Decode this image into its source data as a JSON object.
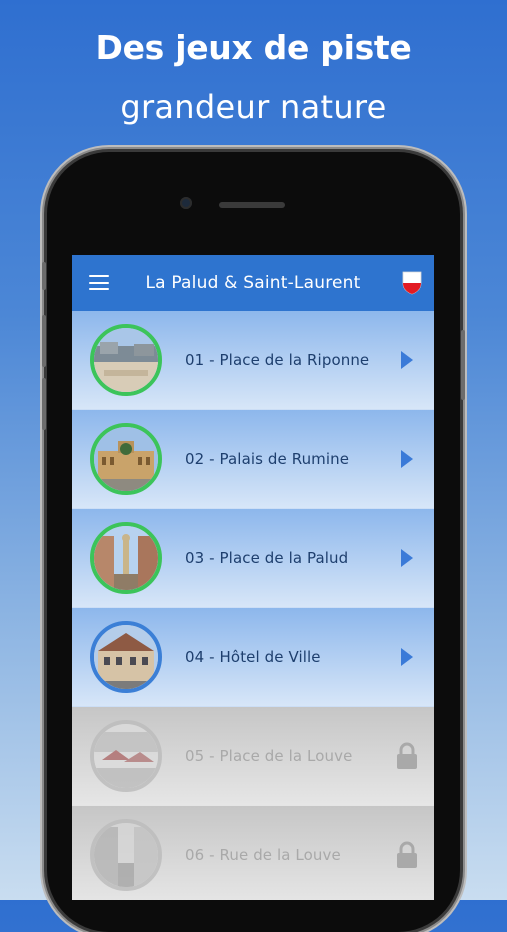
{
  "promo": {
    "line1": "Des jeux de piste",
    "line2": "grandeur nature"
  },
  "app": {
    "title": "La Palud & Saint-Laurent",
    "colors": {
      "appbar": "#2e74cf",
      "unlocked_ring": "#3cc45a",
      "current_ring": "#3b7fd6",
      "locked_ring": "#bdbdbd"
    },
    "icons": {
      "menu": "hamburger-menu-icon",
      "flag": "lausanne-flag-icon",
      "go": "play-arrow-icon",
      "locked": "padlock-icon"
    }
  },
  "stops": [
    {
      "label": "01 - Place de la Riponne",
      "status": "unlocked"
    },
    {
      "label": "02 - Palais de Rumine",
      "status": "unlocked"
    },
    {
      "label": "03 - Place de la Palud",
      "status": "unlocked"
    },
    {
      "label": "04 - Hôtel de Ville",
      "status": "current"
    },
    {
      "label": "05 - Place de la Louve",
      "status": "locked"
    },
    {
      "label": "06 - Rue de la Louve",
      "status": "locked"
    }
  ]
}
